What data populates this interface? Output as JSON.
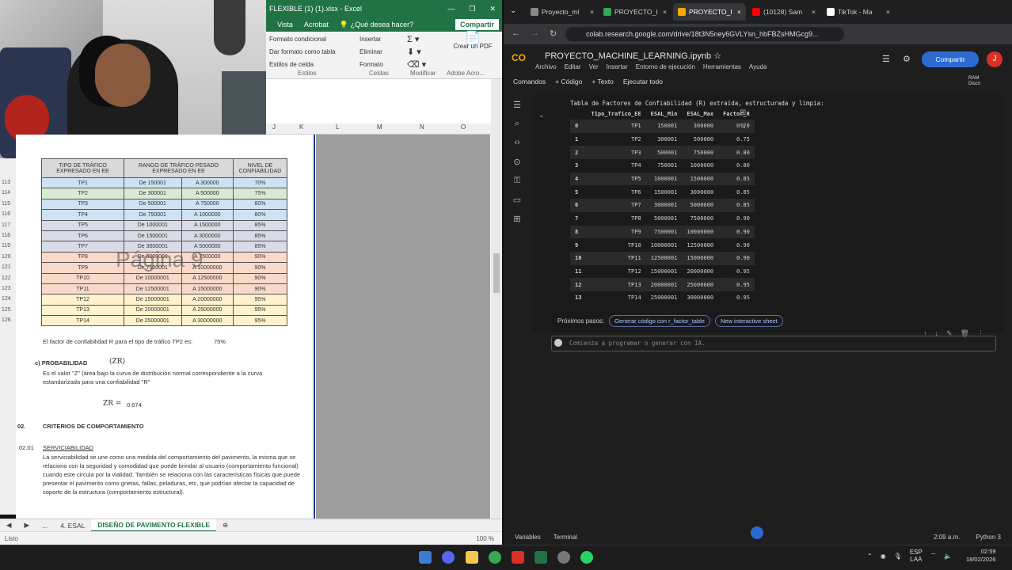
{
  "excel": {
    "title": "FLEXIBLE (1) (1).xlsx - Excel",
    "tabs": [
      "Vista",
      "Acrobat"
    ],
    "tell_me": "¿Qué desea hacer?",
    "share": "Compartir",
    "ribbon": {
      "styles": [
        "Formato condicional",
        "Dar formato como tabla",
        "Estilos de celda"
      ],
      "styles_label": "Estilos",
      "cells": [
        "Insertar",
        "Eliminar",
        "Formato"
      ],
      "cells_label": "Celdas",
      "modify_label": "Modificar",
      "pdf": "Crear un PDF",
      "acrobat_label": "Adobe Acro..."
    },
    "columns": [
      "J",
      "K",
      "L",
      "M",
      "N",
      "O"
    ],
    "traffic_table": {
      "headers": [
        "TIPO DE TRÁFICO EXPRESADO EN EE",
        "RANGO DE TRÁFICO PESADO EXPRESADO EN EE",
        "NIVEL DE CONFIABILIDAD"
      ],
      "rows": [
        {
          "row": "113",
          "type": "TP1",
          "from": "De 150001",
          "to": "A 300000",
          "level": "70%",
          "color": "#cfe2f3"
        },
        {
          "row": "114",
          "type": "TP2",
          "from": "De 300001",
          "to": "A 500000",
          "level": "75%",
          "color": "#d9ead3"
        },
        {
          "row": "115",
          "type": "TP3",
          "from": "De 500001",
          "to": "A 750000",
          "level": "80%",
          "color": "#cfe2f3"
        },
        {
          "row": "116",
          "type": "TP4",
          "from": "De 750001",
          "to": "A 1000000",
          "level": "80%",
          "color": "#cfe2f3"
        },
        {
          "row": "117",
          "type": "TP5",
          "from": "De 1000001",
          "to": "A 1500000",
          "level": "85%",
          "color": "#d9dce6"
        },
        {
          "row": "118",
          "type": "TP6",
          "from": "De 1500001",
          "to": "A 3000000",
          "level": "85%",
          "color": "#d9dce6"
        },
        {
          "row": "119",
          "type": "TP7",
          "from": "De 3000001",
          "to": "A 5000000",
          "level": "85%",
          "color": "#d9dce6"
        },
        {
          "row": "120",
          "type": "TP8",
          "from": "De 5000001",
          "to": "A 7500000",
          "level": "90%",
          "color": "#f9d9c9"
        },
        {
          "row": "121",
          "type": "TP9",
          "from": "De 7500001",
          "to": "A 10000000",
          "level": "90%",
          "color": "#f9d9c9"
        },
        {
          "row": "122",
          "type": "TP10",
          "from": "De 10000001",
          "to": "A 12500000",
          "level": "90%",
          "color": "#f9d9c9"
        },
        {
          "row": "123",
          "type": "TP11",
          "from": "De 12500001",
          "to": "A 15000000",
          "level": "90%",
          "color": "#f9d9c9"
        },
        {
          "row": "124",
          "type": "TP12",
          "from": "De 15000001",
          "to": "A 20000000",
          "level": "95%",
          "color": "#fff2cc"
        },
        {
          "row": "125",
          "type": "TP13",
          "from": "De 20000001",
          "to": "A 25000000",
          "level": "95%",
          "color": "#fff2cc"
        },
        {
          "row": "126",
          "type": "TP14",
          "from": "De 25000001",
          "to": "A 30000000",
          "level": "95%",
          "color": "#fff2cc"
        }
      ]
    },
    "watermark": "Página 9",
    "reliability_text": "El factor de confiabilidad R para el tipo de tráfico TP2 es:",
    "reliability_value": "75%",
    "probability_heading": "c) PROBABILIDAD",
    "zr_symbol": "(ZR)",
    "probability_text": "Es el valor \"Z\" (área bajo la curva de distribución normal correspondiente a la curva estandarizada para una confiabilidad \"R\"",
    "zr_label": "ZR =",
    "zr_value": "0.674",
    "section_num": "02.",
    "section_title": "CRITERIOS DE COMPORTAMIENTO",
    "subsection_num": "02.01",
    "subsection_title": "SERVICIABILIDAD",
    "service_text": "La serviciabilidad se une como una medida del comportamiento del pavimento, la misma que se relaciona con la seguridad y comodidad que puede brindar al usuario (comportamiento funcional) cuando este circula por la vialidad. También se relaciona con las características físicas que puede presentar el pavimento como grietas, fallas, peladuras, etc, que podrían afectar la capacidad de soporte de la estructura (comportamiento estructural).",
    "sheet_tabs": [
      "...",
      "4. ESAL",
      "DISEÑO DE PAVIMENTO FLEXIBLE"
    ],
    "status_left": "Listo",
    "zoom": "100 %"
  },
  "browser": {
    "tabs": [
      {
        "label": "Proyecto_ml",
        "color": "#888"
      },
      {
        "label": "PROYECTO_I",
        "color": "#34a853"
      },
      {
        "label": "PROYECTO_I",
        "color": "#f9ab00"
      },
      {
        "label": "(10128) Sam",
        "color": "#ff0000"
      },
      {
        "label": "TikTok - Ma",
        "color": "#ffffff"
      }
    ],
    "url": "colab.research.google.com/drive/18t3N5ney6GVLYsn_hbFBZsHMGcg9..."
  },
  "colab": {
    "notebook": "PROYECTO_MACHINE_LEARNING.ipynb",
    "menu": [
      "Archivo",
      "Editar",
      "Ver",
      "Insertar",
      "Entorno de ejecución",
      "Herramientas",
      "Ayuda"
    ],
    "share": "Compartir",
    "avatar": "J",
    "toolbar": [
      "Comandos",
      "+ Código",
      "+ Texto",
      "Ejecutar todo"
    ],
    "ram_label": "RAM",
    "disk_label": "Disco",
    "output_title": "Tabla de Factores de Confiabilidad (R) extraída, estructurada y limpia:",
    "df_headers": [
      "",
      "Tipo_Trafico_EE",
      "ESAL_Min",
      "ESAL_Max",
      "Factor_R"
    ],
    "df_rows": [
      [
        "0",
        "TP1",
        "150001",
        "300000",
        "0.70"
      ],
      [
        "1",
        "TP2",
        "300001",
        "500000",
        "0.75"
      ],
      [
        "2",
        "TP3",
        "500001",
        "750000",
        "0.80"
      ],
      [
        "3",
        "TP4",
        "750001",
        "1000000",
        "0.80"
      ],
      [
        "4",
        "TP5",
        "1000001",
        "1500000",
        "0.85"
      ],
      [
        "5",
        "TP6",
        "1500001",
        "3000000",
        "0.85"
      ],
      [
        "6",
        "TP7",
        "3000001",
        "5000000",
        "0.85"
      ],
      [
        "7",
        "TP8",
        "5000001",
        "7500000",
        "0.90"
      ],
      [
        "8",
        "TP9",
        "7500001",
        "10000000",
        "0.90"
      ],
      [
        "9",
        "TP10",
        "10000001",
        "12500000",
        "0.90"
      ],
      [
        "10",
        "TP11",
        "12500001",
        "15000000",
        "0.90"
      ],
      [
        "11",
        "TP12",
        "15000001",
        "20000000",
        "0.95"
      ],
      [
        "12",
        "TP13",
        "20000001",
        "25000000",
        "0.95"
      ],
      [
        "13",
        "TP14",
        "25000001",
        "30000000",
        "0.95"
      ]
    ],
    "next_steps_label": "Próximos pasos:",
    "chip1": "Generar código con r_factor_table",
    "chip2": "New interactive sheet",
    "new_cell_placeholder": "Comienza a programar o generar con IA.",
    "footer_vars": "Variables",
    "footer_terminal": "Terminal",
    "footer_time": "2:09 a.m.",
    "footer_python": "Python 3"
  },
  "taskbar": {
    "lang": "ESP",
    "lang2": "LAA",
    "time": "02:59",
    "date": "18/02/2026"
  }
}
